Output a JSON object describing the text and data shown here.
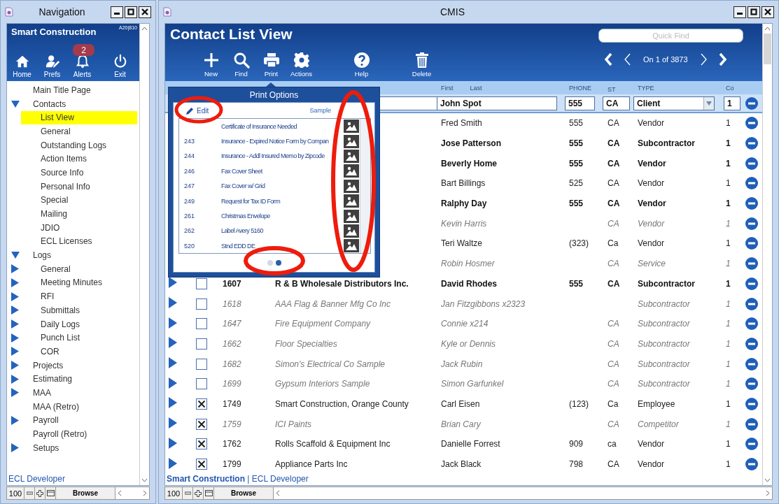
{
  "nav_window": {
    "title": "Navigation",
    "app_name": "Smart Construction",
    "version": "A20|810",
    "buttons": [
      {
        "kind": "home",
        "label": "Home"
      },
      {
        "kind": "prefs",
        "label": "Prefs"
      },
      {
        "kind": "alerts",
        "label": "Alerts",
        "badge": "2"
      },
      {
        "kind": "exit",
        "label": "Exit"
      }
    ],
    "tree": [
      {
        "label": "Main Title Page",
        "kind": "page",
        "selected": false
      },
      {
        "label": "Contacts",
        "kind": "folder",
        "expanded": true,
        "selected": false,
        "children": [
          {
            "label": "List View",
            "kind": "page",
            "selected": true
          },
          {
            "label": "General",
            "kind": "page",
            "selected": false
          },
          {
            "label": "Outstanding Logs",
            "kind": "page",
            "selected": false
          },
          {
            "label": "Action Items",
            "kind": "page",
            "selected": false
          },
          {
            "label": "Source Info",
            "kind": "page",
            "selected": false
          },
          {
            "label": "Personal Info",
            "kind": "page",
            "selected": false
          },
          {
            "label": "Special",
            "kind": "page",
            "selected": false
          },
          {
            "label": "Mailing",
            "kind": "page",
            "selected": false
          },
          {
            "label": "JDIO",
            "kind": "page",
            "selected": false
          },
          {
            "label": "ECL Licenses",
            "kind": "page",
            "selected": false
          }
        ]
      },
      {
        "label": "Logs",
        "kind": "folder",
        "expanded": true,
        "selected": false,
        "children": [
          {
            "label": "General",
            "kind": "folder",
            "expanded": false,
            "selected": false
          },
          {
            "label": "Meeting Minutes",
            "kind": "folder",
            "expanded": false,
            "selected": false
          },
          {
            "label": "RFI",
            "kind": "folder",
            "expanded": false,
            "selected": false
          },
          {
            "label": "Submittals",
            "kind": "folder",
            "expanded": false,
            "selected": false
          },
          {
            "label": "Daily Logs",
            "kind": "folder",
            "expanded": false,
            "selected": false
          },
          {
            "label": "Punch List",
            "kind": "folder",
            "expanded": false,
            "selected": false
          },
          {
            "label": "COR",
            "kind": "folder",
            "expanded": false,
            "selected": false
          }
        ]
      },
      {
        "label": "Projects",
        "kind": "folder",
        "expanded": false,
        "selected": false
      },
      {
        "label": "Estimating",
        "kind": "folder",
        "expanded": false,
        "selected": false
      },
      {
        "label": "MAA",
        "kind": "folder",
        "expanded": false,
        "selected": false
      },
      {
        "label": "MAA (Retro)",
        "kind": "page",
        "selected": false
      },
      {
        "label": "Payroll",
        "kind": "folder",
        "expanded": false,
        "selected": false
      },
      {
        "label": "Payroll (Retro)",
        "kind": "page",
        "selected": false
      },
      {
        "label": "Setups",
        "kind": "folder",
        "expanded": false,
        "selected": false
      }
    ],
    "footer": "ECL Developer",
    "status": {
      "zoom": "100",
      "mode": "Browse"
    }
  },
  "main_window": {
    "title": "CMIS",
    "heading": "Contact List View",
    "quick_find": {
      "placeholder": "Quick Find"
    },
    "toolbar": [
      {
        "kind": "new",
        "label": "New"
      },
      {
        "kind": "find",
        "label": "Find"
      },
      {
        "kind": "print",
        "label": "Print"
      },
      {
        "kind": "actions",
        "label": "Actions"
      },
      {
        "kind": "help",
        "label": "Help"
      },
      {
        "kind": "delete",
        "label": "Delete"
      }
    ],
    "record_position": "On 1 of 3873",
    "columns": [
      "First",
      "Last",
      "PHONE",
      "ST",
      "TYPE",
      "Co"
    ],
    "edit_row": {
      "name": "John Spot",
      "phone": "555",
      "st": "CA",
      "type": "Client",
      "co": "1"
    },
    "rows": [
      {
        "name": "Fred Smith",
        "phone": "555",
        "st": "CA",
        "type": "Vendor",
        "co": "1",
        "highlighted": false,
        "inactive": false
      },
      {
        "name": "Jose Patterson",
        "phone": "555",
        "st": "CA",
        "type": "Subcontractor",
        "co": "1",
        "highlighted": true,
        "inactive": false
      },
      {
        "name": "Beverly Home",
        "phone": "555",
        "st": "CA",
        "type": "Vendor",
        "co": "1",
        "highlighted": true,
        "inactive": false
      },
      {
        "name": "Bart Billings",
        "phone": "525",
        "st": "CA",
        "type": "Vendor",
        "co": "1",
        "highlighted": false,
        "inactive": false
      },
      {
        "name": "Ralphy Day",
        "phone": "555",
        "st": "CA",
        "type": "Vendor",
        "co": "1",
        "highlighted": true,
        "inactive": false
      },
      {
        "name": "Kevin Harris",
        "st": "CA",
        "type": "Vendor",
        "co": "1",
        "highlighted": false,
        "inactive": true
      },
      {
        "name": "Teri Waltze",
        "phone": "(323)",
        "st": "Ca",
        "type": "Vendor",
        "co": "1",
        "highlighted": false,
        "inactive": false
      },
      {
        "name": "Robin Hosmer",
        "st": "CA",
        "type": "Service",
        "co": "1",
        "highlighted": false,
        "inactive": true
      },
      {
        "checked": false,
        "code": "1607",
        "company": "R & B Wholesale Distributors Inc.",
        "name": "David Rhodes",
        "phone": "555",
        "st": "CA",
        "type": "Subcontractor",
        "co": "1",
        "highlighted": true,
        "inactive": false
      },
      {
        "checked": false,
        "code": "1618",
        "company": "AAA Flag & Banner Mfg Co Inc",
        "name": "Jan Fitzgibbons x2323",
        "type": "Subcontractor",
        "co": "1",
        "highlighted": false,
        "inactive": true
      },
      {
        "checked": false,
        "code": "1647",
        "company": "Fire Equipment Company",
        "name": "Connie x214",
        "st": "CA",
        "type": "Subcontractor",
        "co": "1",
        "highlighted": false,
        "inactive": true
      },
      {
        "checked": false,
        "code": "1662",
        "company": "Floor Specialties",
        "name": "Kyle or Dennis",
        "st": "CA",
        "type": "Subcontractor",
        "co": "1",
        "highlighted": false,
        "inactive": true
      },
      {
        "checked": false,
        "code": "1682",
        "company": "Simon's Electrical Co Sample",
        "name": "Jack Rubin",
        "st": "CA",
        "type": "Subcontractor",
        "co": "1",
        "highlighted": false,
        "inactive": true
      },
      {
        "checked": false,
        "code": "1699",
        "company": "Gypsum Interiors Sample",
        "name": "Simon Garfunkel",
        "st": "CA",
        "type": "Subcontractor",
        "co": "1",
        "highlighted": false,
        "inactive": true
      },
      {
        "checked": true,
        "code": "1749",
        "company": "Smart Construction, Orange County",
        "name": "Carl Eisen",
        "phone": "(123)",
        "st": "Ca",
        "type": "Employee",
        "co": "1",
        "highlighted": false,
        "inactive": false
      },
      {
        "checked": true,
        "code": "1759",
        "company": "ICI Paints",
        "name": "Brian Cary",
        "st": "CA",
        "type": "Competitor",
        "co": "1",
        "highlighted": false,
        "inactive": true
      },
      {
        "checked": true,
        "code": "1762",
        "company": "Rolls Scaffold & Equipment Inc",
        "name": "Danielle Forrest",
        "phone": "909",
        "st": "ca",
        "type": "Vendor",
        "co": "1",
        "highlighted": false,
        "inactive": false
      },
      {
        "checked": true,
        "code": "1799",
        "company": "Appliance Parts Inc",
        "name": "Jack Black",
        "phone": "798",
        "st": "CA",
        "type": "Vendor",
        "co": "1",
        "highlighted": false,
        "inactive": false
      }
    ],
    "footer": "**Smart Construction** | ECL Developer",
    "status": {
      "zoom": "100",
      "mode": "Browse"
    }
  },
  "print_options": {
    "title": "Print Options",
    "edit": "Edit",
    "edit_circled": true,
    "sample_header": "Sample",
    "sample_circled": true,
    "items": [
      {
        "name": "Certificate of Insurance Needed"
      },
      {
        "code": "243",
        "name": "Insurance - Expired Notice Form by Compan"
      },
      {
        "code": "244",
        "name": "Insurance - Addl Insured Memo by Zipcode"
      },
      {
        "code": "246",
        "name": "Fax Cover Sheet"
      },
      {
        "code": "247",
        "name": "Fax Cover w/ Grid"
      },
      {
        "code": "249",
        "name": "Request for Tax ID Form"
      },
      {
        "code": "261",
        "name": "Christmas Envelope"
      },
      {
        "code": "262",
        "name": "Label Avery 5160"
      },
      {
        "code": "520",
        "name": "Stnd EDD DE"
      }
    ],
    "pages": [
      {
        "selected": false
      },
      {
        "selected": true
      }
    ],
    "pager_circled": true
  }
}
